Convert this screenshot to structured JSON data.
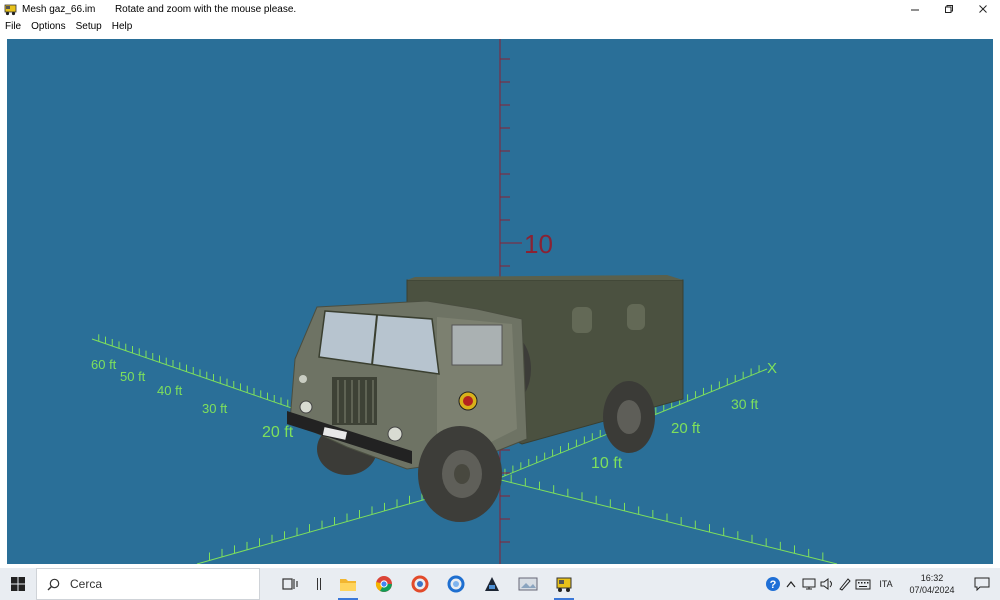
{
  "window": {
    "title": "Mesh gaz_66.im",
    "hint": "Rotate and zoom with the mouse please."
  },
  "menu": [
    "File",
    "Options",
    "Setup",
    "Help"
  ],
  "viewport": {
    "background": "#2a6f98",
    "vertical_axis_label": "10",
    "axis_x_label": "X",
    "left_ticks": [
      "60 ft",
      "50 ft",
      "40 ft",
      "30 ft",
      "20 ft"
    ],
    "right_ticks": [
      "10 ft",
      "20 ft",
      "30 ft"
    ],
    "grid_color": "#7ee05c",
    "vertical_axis_color": "#8a2233"
  },
  "taskbar": {
    "search_placeholder": "Cerca",
    "language": "ITA",
    "time": "16:32",
    "date": "07/04/2024"
  }
}
